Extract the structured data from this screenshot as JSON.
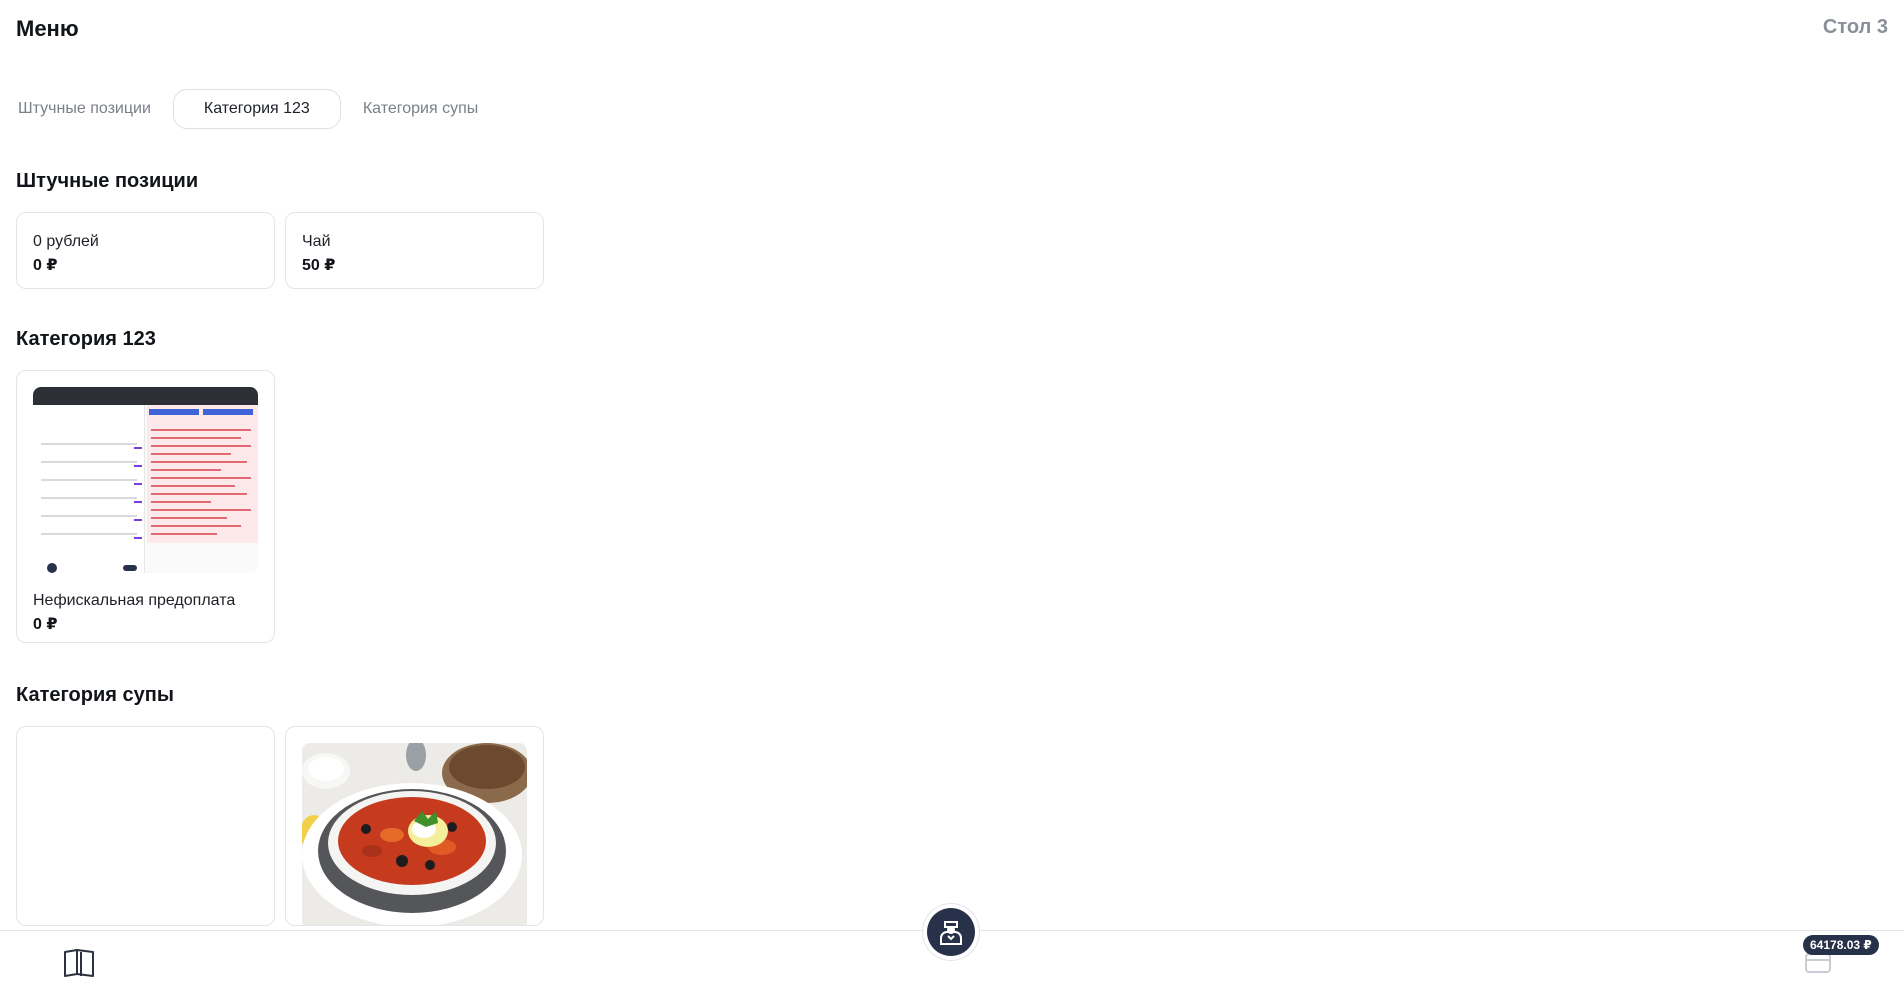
{
  "header": {
    "title": "Меню",
    "table": "Стол 3"
  },
  "tabs": [
    {
      "label": "Штучные позиции",
      "active": false
    },
    {
      "label": "Категория 123",
      "active": true
    },
    {
      "label": "Категория супы",
      "active": false
    }
  ],
  "sections": [
    {
      "title": "Штучные позиции",
      "items": [
        {
          "name": "0 рублей",
          "price": "0 ₽"
        },
        {
          "name": "Чай",
          "price": "50 ₽"
        }
      ]
    },
    {
      "title": "Категория 123",
      "items": [
        {
          "name": "Нефискальная предоплата",
          "price": "0 ₽",
          "image": "screenshot-thumbnail"
        }
      ]
    },
    {
      "title": "Категория супы",
      "items": [
        {
          "image": "blank"
        },
        {
          "image": "solyanka-soup-photo"
        }
      ]
    }
  ],
  "bottom_bar": {
    "menu_icon": "open-book-icon",
    "waiter_icon": "waiter-icon",
    "cart_icon": "card-icon",
    "total": "64178.03 ₽"
  },
  "colors": {
    "accent_dark": "#273149",
    "muted_text": "#8a8f99",
    "border": "#e3e5e8"
  }
}
